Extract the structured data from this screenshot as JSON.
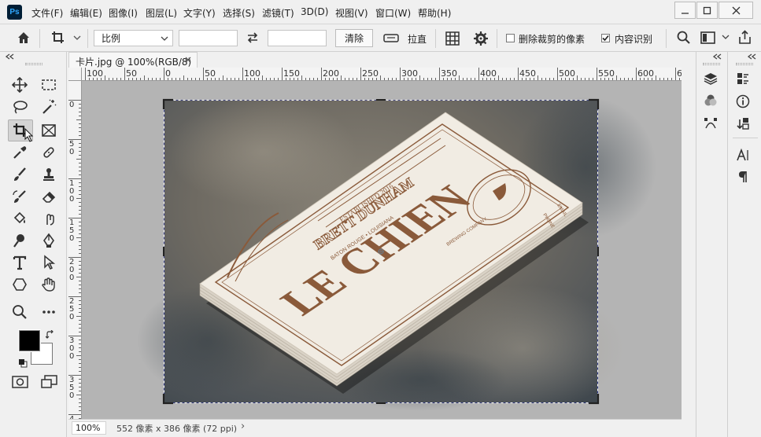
{
  "app": {
    "logo_text": "Ps"
  },
  "menu": [
    "文件(F)",
    "编辑(E)",
    "图像(I)",
    "图层(L)",
    "文字(Y)",
    "选择(S)",
    "滤镜(T)",
    "3D(D)",
    "视图(V)",
    "窗口(W)",
    "帮助(H)"
  ],
  "options": {
    "ratio_label": "比例",
    "clear_label": "清除",
    "straighten_label": "拉直",
    "delete_cropped_label": "删除裁剪的像素",
    "delete_cropped_checked": false,
    "content_aware_label": "内容识别",
    "content_aware_checked": true
  },
  "document": {
    "tab_title": "卡片.jpg @ 100%(RGB/8)",
    "tab_close": "×",
    "ruler_h_labels": [
      "100",
      "50",
      "0",
      "50",
      "100",
      "150",
      "200",
      "250",
      "300",
      "350",
      "400",
      "450",
      "500",
      "550",
      "600",
      "6"
    ],
    "ruler_v_labels": [
      "0",
      "5\n0",
      "1\n0\n0",
      "1\n5\n0",
      "2\n0\n0",
      "2\n5\n0",
      "3\n0\n0",
      "3\n5\n0",
      "4"
    ]
  },
  "status": {
    "zoom": "100%",
    "doc_info": "552 像素 x 386 像素 (72 ppi)",
    "arrow": "›"
  },
  "card": {
    "established": "ESTABLISHED 2016",
    "name": "BRETT DUNHAM",
    "location": "BATON ROUGE • LOUISIANA",
    "brand": "LE CHIEN",
    "company": "BREWING COMPANY",
    "phone_label": "PHONE",
    "email_label": "EMAIL"
  },
  "colors": {
    "accent": "#31a8ff",
    "foreground": "#000000",
    "background": "#ffffff",
    "card_ink": "#8a5a3a"
  }
}
